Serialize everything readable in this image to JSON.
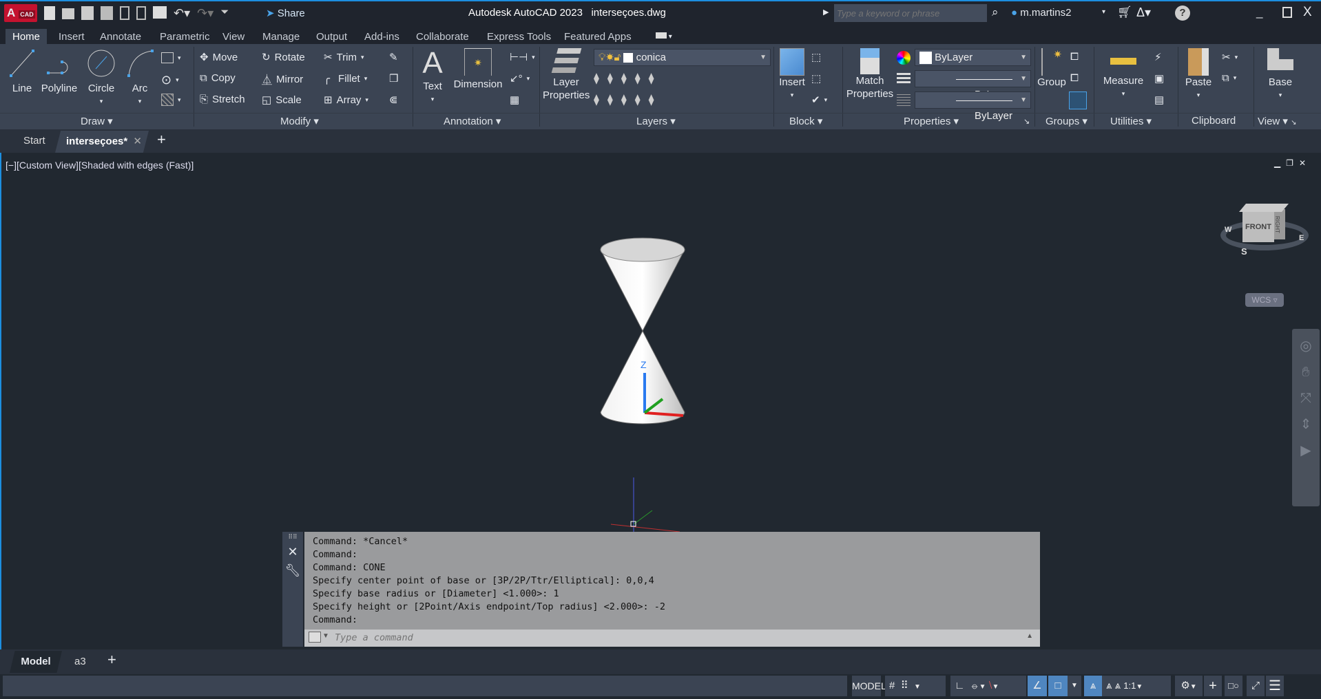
{
  "app": {
    "title": "Autodesk AutoCAD 2023",
    "file": "interseçoes.dwg",
    "logo": "A",
    "logo_sub": "CAD",
    "share": "Share",
    "search_placeholder": "Type a keyword or phrase",
    "user": "m.martins2"
  },
  "ribbon_tabs": [
    "Home",
    "Insert",
    "Annotate",
    "Parametric",
    "View",
    "Manage",
    "Output",
    "Add-ins",
    "Collaborate",
    "Express Tools",
    "Featured Apps"
  ],
  "draw": {
    "label": "Draw",
    "line": "Line",
    "polyline": "Polyline",
    "circle": "Circle",
    "arc": "Arc"
  },
  "modify": {
    "label": "Modify",
    "move": "Move",
    "rotate": "Rotate",
    "trim": "Trim",
    "copy": "Copy",
    "mirror": "Mirror",
    "fillet": "Fillet",
    "stretch": "Stretch",
    "scale": "Scale",
    "array": "Array"
  },
  "annotation": {
    "label": "Annotation",
    "text": "Text",
    "dimension": "Dimension"
  },
  "layers": {
    "label": "Layers",
    "layer_properties": [
      "Layer",
      "Properties"
    ],
    "current_layer": "conica"
  },
  "block": {
    "label": "Block",
    "insert": "Insert"
  },
  "properties": {
    "label": "Properties",
    "match": [
      "Match",
      "Properties"
    ],
    "color": "ByLayer",
    "linetype": "ByLayer",
    "lineweight": "ByLayer"
  },
  "groups": {
    "label": "Groups",
    "group": "Group"
  },
  "utilities": {
    "label": "Utilities",
    "measure": "Measure"
  },
  "clipboard": {
    "label": "Clipboard",
    "paste": "Paste"
  },
  "view": {
    "label": "View",
    "base": "Base"
  },
  "file_tabs": {
    "start": "Start",
    "current": "interseçoes*"
  },
  "viewport": {
    "label": "[−][Custom View][Shaded with edges (Fast)]",
    "viewcube": {
      "face": "FRONT",
      "right": "RIGHT",
      "compass": [
        "W",
        "S",
        "E"
      ]
    },
    "ucs_menu": "WCS"
  },
  "command": {
    "history": [
      "Command: *Cancel*",
      "Command:",
      "Command: CONE",
      "Specify center point of base or [3P/2P/Ttr/Elliptical]: 0,0,4",
      "Specify base radius or [Diameter] <1.000>: 1",
      "Specify height or [2Point/Axis endpoint/Top radius] <2.000>: -2",
      "Command:"
    ],
    "placeholder": "Type a command"
  },
  "layout_tabs": [
    "Model",
    "a3"
  ],
  "status": {
    "model": "MODEL",
    "scale": "1:1"
  },
  "colors": {
    "accent": "#1c8fe0",
    "ribbon": "#3b4453",
    "bg": "#212830"
  }
}
